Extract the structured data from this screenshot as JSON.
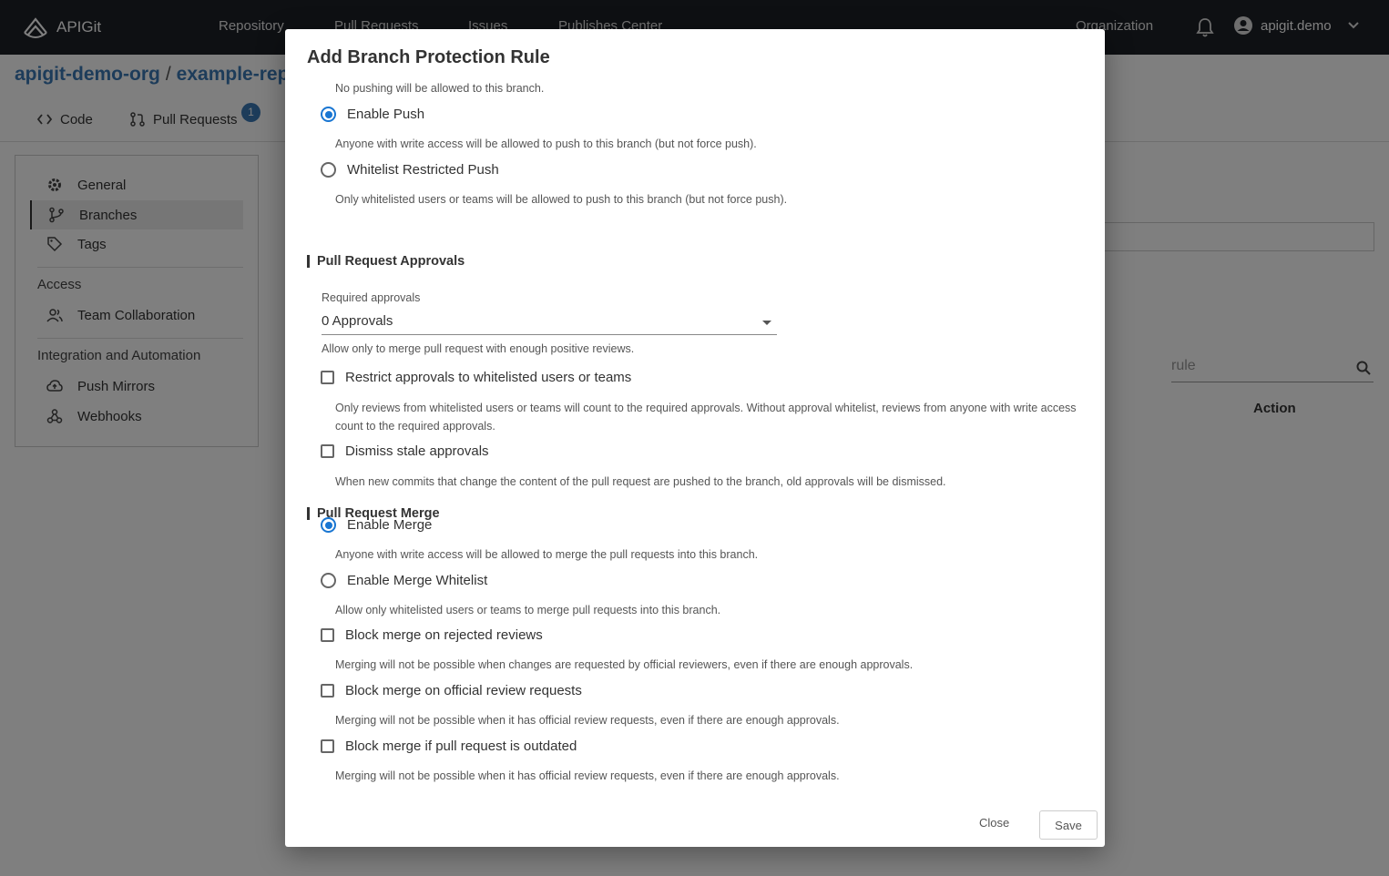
{
  "header": {
    "brand": "APIGit",
    "nav": [
      "Repository",
      "Pull Requests",
      "Issues",
      "Publishes Center"
    ],
    "organization": "Organization",
    "username": "apigit.demo"
  },
  "breadcrumb": {
    "org": "apigit-demo-org",
    "separator": "/",
    "repo": "example-repo"
  },
  "repo_tabs": {
    "code": "Code",
    "pull_requests": "Pull Requests",
    "pr_count": "1"
  },
  "sidebar": {
    "general": "General",
    "branches": "Branches",
    "tags": "Tags",
    "access_heading": "Access",
    "team_collaboration": "Team Collaboration",
    "integration_heading": "Integration and Automation",
    "push_mirrors": "Push Mirrors",
    "webhooks": "Webhooks"
  },
  "background": {
    "search_placeholder": "rule",
    "action_header": "Action"
  },
  "dialog": {
    "title": "Add Branch Protection Rule",
    "clipped_hint": "No pushing will be allowed to this branch.",
    "push": {
      "enable_push": "Enable Push",
      "enable_push_hint": "Anyone with write access will be allowed to push to this branch (but not force push).",
      "whitelist_push": "Whitelist Restricted Push",
      "whitelist_push_hint": "Only whitelisted users or teams will be allowed to push to this branch (but not force push).",
      "selected": "Enable Push"
    },
    "approvals": {
      "heading": "Pull Request Approvals",
      "required_label": "Required approvals",
      "required_value": "0 Approvals",
      "required_hint": "Allow only to merge pull request with enough positive reviews.",
      "restrict_label": "Restrict approvals to whitelisted users or teams",
      "restrict_hint": "Only reviews from whitelisted users or teams will count to the required approvals. Without approval whitelist, reviews from anyone with write access count to the required approvals.",
      "dismiss_label": "Dismiss stale approvals",
      "dismiss_hint": "When new commits that change the content of the pull request are pushed to the branch, old approvals will be dismissed."
    },
    "merge": {
      "heading": "Pull Request Merge",
      "enable_merge": "Enable Merge",
      "enable_merge_hint": "Anyone with write access will be allowed to merge the pull requests into this branch.",
      "merge_whitelist": "Enable Merge Whitelist",
      "merge_whitelist_hint": "Allow only whitelisted users or teams to merge pull requests into this branch.",
      "block_rejected": "Block merge on rejected reviews",
      "block_rejected_hint": "Merging will not be possible when changes are requested by official reviewers, even if there are enough approvals.",
      "block_official": "Block merge on official review requests",
      "block_official_hint": "Merging will not be possible when it has official review requests, even if there are enough approvals.",
      "block_outdated": "Block merge if pull request is outdated",
      "block_outdated_hint": "Merging will not be possible when it has official review requests, even if there are enough approvals.",
      "selected": "Enable Merge"
    },
    "close_label": "Close",
    "save_label": "Save"
  },
  "colors": {
    "topbar": "#1d2027",
    "link": "#3a78b5",
    "radio_active": "#1976d2"
  }
}
